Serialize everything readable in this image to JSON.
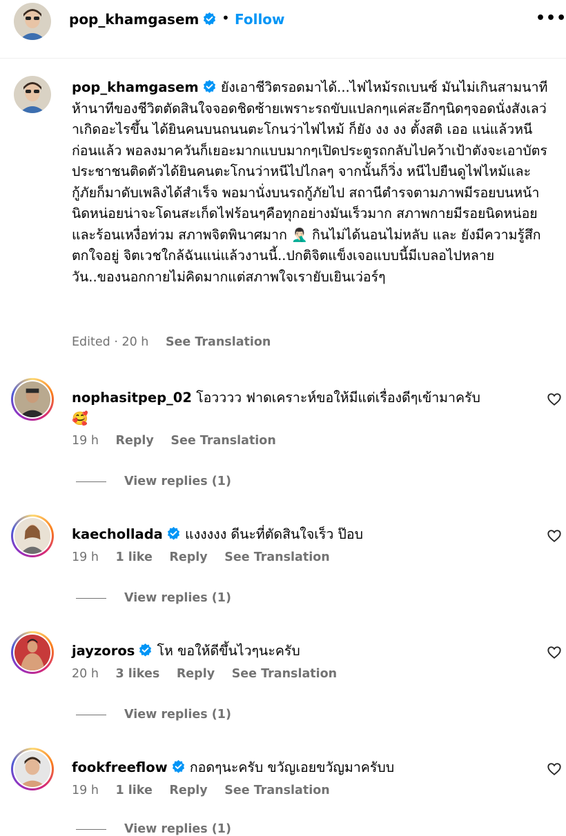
{
  "header": {
    "username": "pop_khamgasem",
    "separator": "•",
    "follow": "Follow",
    "more": "•••"
  },
  "caption": {
    "username": "pop_khamgasem",
    "text": "ยังเอาชีวิตรอดมาได้...ไฟไหม้รถเบนซ์ มันไม่เกินสามนาทีห้านาทีของชีวิตตัดสินใจจอดชิดซ้ายเพราะรถขับแปลกๆแค่สะอึกๆนิดๆจอดนั่งสังเลว่าเกิดอะไรขึ้น ได้ยินคนบนถนนตะโกนว่าไฟไหม้ ก็ยัง งง งง ตั้งสติ เออ แน่แล้วหนีก่อนแล้ว พอลงมาควันก็เยอะมากแบบมากๆเปิดประตูรถกลับไปคว้าเป้าตังจะเอาบัตรประชาชนติดตัวได้ยินคนตะโกนว่าหนีไปไกลๆ จากนั้นก็วิ่ง หนีไปยืนดูไฟไหม้และกู้ภัยก็มาดับเพลิงได้สำเร็จ พอมานั่งบนรถกู้ภัยไป สถานีตำรจตามภาพมีรอยบนหน้านิดหน่อยน่าจะโดนสะเก็ดไฟร้อนๆคือทุกอย่างมันเร็วมาก สภาพกายมีรอยนิดหน่อยและร้อนเหงื่อท่วม สภาพจิตพินาศมาก",
    "emoji": "🤦🏻‍♂️",
    "text_after": " กินไม่ได้นอนไม่หลับ และ ยังมีความรู้สึกตกใจอยู่ จิตเวชใกล้ฉันแน่แล้วงานนี้..ปกติจิตแข็งเจอแบบนี้มีเบลอไปหลายวัน..ของนอกกายไม่คิดมากแต่สภาพใจเรายับเยินเว่อร์ๆ",
    "edited": "Edited · 20 h",
    "see_translation": "See Translation"
  },
  "comments": [
    {
      "username": "nophasitpep_02",
      "text": "โอวววว ฟาดเคราะห์ขอให้มีแต่เรื่องดีๆเข้ามาครับ",
      "emoji": "🥰",
      "time": "19 h",
      "likes": "",
      "reply": "Reply",
      "see_translation": "See Translation",
      "view_replies": "View replies (1)"
    },
    {
      "username": "kaechollada",
      "text": "แงงงงง ดีนะที่ตัดสินใจเร็ว ป๊อบ",
      "time": "19 h",
      "likes": "1 like",
      "reply": "Reply",
      "see_translation": "See Translation",
      "view_replies": "View replies (1)"
    },
    {
      "username": "jayzoros",
      "text": "โห ขอให้ดีขึ้นไวๆนะครับ",
      "time": "20 h",
      "likes": "3 likes",
      "reply": "Reply",
      "see_translation": "See Translation",
      "view_replies": "View replies (1)"
    },
    {
      "username": "fookfreeflow",
      "text": "กอดๆนะครับ ขวัญเอยขวัญมาครับบ",
      "time": "19 h",
      "likes": "1 like",
      "reply": "Reply",
      "see_translation": "See Translation",
      "view_replies": "View replies (1)"
    }
  ],
  "colors": {
    "accent": "#0095f6",
    "verified": "#0095f6",
    "muted": "#737373"
  },
  "icons": {
    "verified": "verified-badge-icon",
    "heart": "heart-outline-icon",
    "more": "more-horizontal-icon"
  }
}
